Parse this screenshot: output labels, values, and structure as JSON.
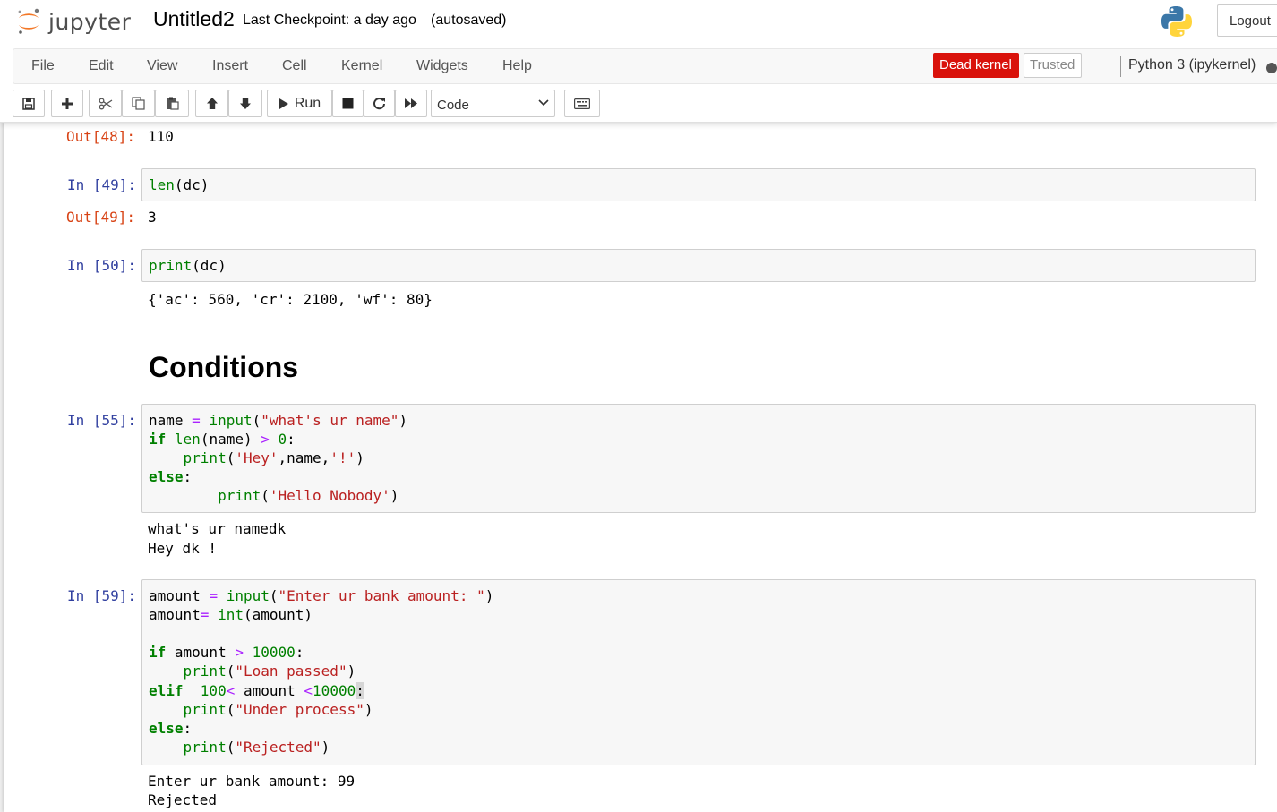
{
  "app": {
    "logo_text": "jupyter",
    "notebook_title": "Untitled2",
    "checkpoint": "Last Checkpoint: a day ago",
    "autosave": "(autosaved)",
    "logout": "Logout"
  },
  "menu": [
    "File",
    "Edit",
    "View",
    "Insert",
    "Cell",
    "Kernel",
    "Widgets",
    "Help"
  ],
  "kernel": {
    "status_badge": "Dead kernel",
    "status_color": "#d9120b",
    "trusted": "Trusted",
    "name": "Python 3 (ipykernel)"
  },
  "toolbar": {
    "icons": [
      "save-icon",
      "plus-icon",
      "scissors-icon",
      "copy-icon",
      "paste-icon",
      "arrow-up-icon",
      "arrow-down-icon",
      "play-icon",
      "stop-icon",
      "restart-icon",
      "fast-forward-icon",
      "keyboard-icon"
    ],
    "run_label": "Run",
    "cell_type": "Code"
  },
  "cells": {
    "out48": {
      "prompt": "Out[48]:",
      "text": "110"
    },
    "c49": {
      "prompt": "In [49]:",
      "code": "len(dc)",
      "out_prompt": "Out[49]:",
      "out": "3"
    },
    "c50": {
      "prompt": "In [50]:",
      "code": "print(dc)",
      "out": "{'ac': 560, 'cr': 2100, 'wf': 80}"
    },
    "markdown_heading": "Conditions",
    "c55": {
      "prompt": "In [55]:",
      "code": [
        "name = input(\"what's ur name\")",
        "if len(name) > 0:",
        "    print('Hey',name,'!')",
        "else:",
        "        print('Hello Nobody')"
      ],
      "out": [
        "what's ur namedk",
        "Hey dk !"
      ]
    },
    "c59": {
      "prompt": "In [59]:",
      "code": [
        "amount = input(\"Enter ur bank amount: \")",
        "amount= int(amount)",
        "",
        "if amount > 10000:",
        "    print(\"Loan passed\")",
        "elif  100< amount <10000:",
        "    print(\"Under process\")",
        "else:",
        "    print(\"Rejected\")"
      ],
      "out": [
        "Enter ur bank amount: 99",
        "Rejected"
      ]
    }
  }
}
